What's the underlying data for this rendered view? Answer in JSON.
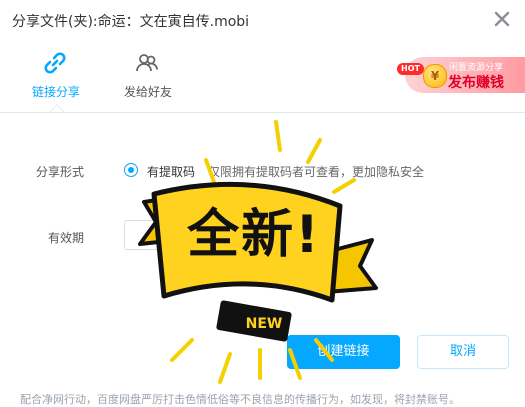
{
  "window": {
    "title": "分享文件(夹):命运：文在寅自传.mobi",
    "close_icon": "close-icon"
  },
  "tabs": [
    {
      "label": "链接分享",
      "icon": "link-icon",
      "active": true
    },
    {
      "label": "发给好友",
      "icon": "friends-icon",
      "active": false
    }
  ],
  "promo": {
    "hot_badge": "HOT",
    "coin_symbol": "¥",
    "subtitle": "闲置资源分享",
    "title": "发布赚钱"
  },
  "form": {
    "share_format_label": "分享形式",
    "share_option_label": "有提取码",
    "share_option_desc": "仅限拥有提取码者可查看，更加隐私安全",
    "validity_label": "有效期"
  },
  "buttons": {
    "create": "创建链接",
    "cancel": "取消"
  },
  "footer": {
    "notice": "配合净网行动，百度网盘严厉打击色情低俗等不良信息的传播行为，如发现，将封禁账号。"
  },
  "sticker": {
    "main_text": "全新!",
    "badge_text": "NEW"
  },
  "colors": {
    "accent": "#06a7ff",
    "sticker_yellow": "#ffd21f",
    "sticker_black": "#111111",
    "promo_red": "#e0002a"
  }
}
